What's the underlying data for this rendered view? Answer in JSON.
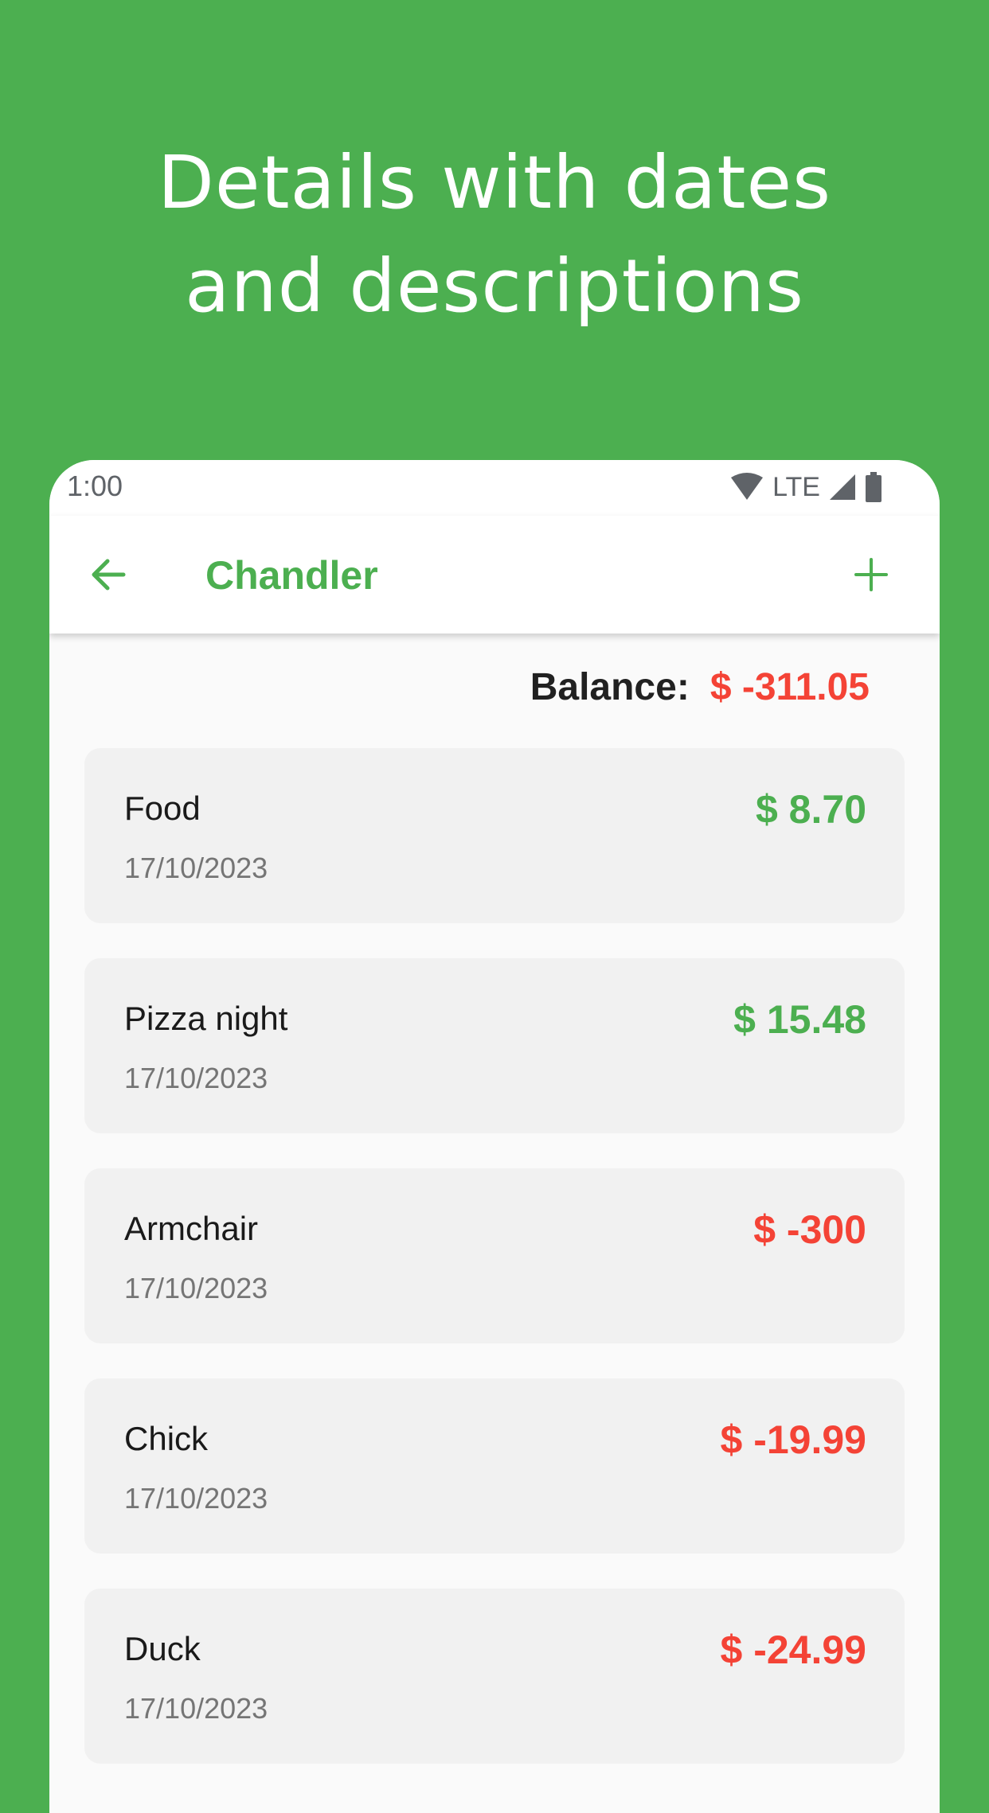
{
  "headline": {
    "line1": "Details with dates",
    "line2": "and descriptions"
  },
  "status_bar": {
    "time": "1:00",
    "network": "LTE",
    "icons": [
      "wifi-icon",
      "signal-icon",
      "battery-icon"
    ]
  },
  "app_bar": {
    "title": "Chandler",
    "back_icon": "arrow-left-icon",
    "add_icon": "plus-icon"
  },
  "balance": {
    "label": "Balance:",
    "value": "$ -311.05"
  },
  "colors": {
    "brand_green": "#4caf50",
    "negative_red": "#f44336",
    "card_bg": "#f1f1f1"
  },
  "transactions": [
    {
      "title": "Food",
      "date": "17/10/2023",
      "amount": "$ 8.70",
      "sign": "positive"
    },
    {
      "title": "Pizza night",
      "date": "17/10/2023",
      "amount": "$ 15.48",
      "sign": "positive"
    },
    {
      "title": "Armchair",
      "date": "17/10/2023",
      "amount": "$ -300",
      "sign": "negative"
    },
    {
      "title": "Chick",
      "date": "17/10/2023",
      "amount": "$ -19.99",
      "sign": "negative"
    },
    {
      "title": "Duck",
      "date": "17/10/2023",
      "amount": "$ -24.99",
      "sign": "negative"
    }
  ]
}
